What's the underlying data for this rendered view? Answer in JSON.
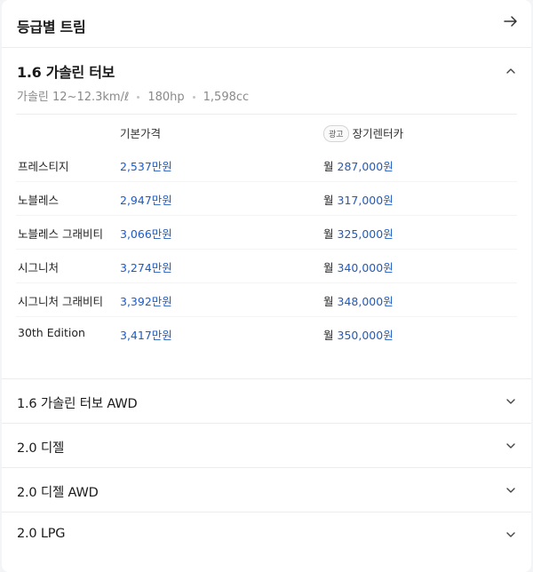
{
  "header": {
    "title": "등급별 트림"
  },
  "open_section": {
    "title": "1.6 가솔린 터보",
    "specs": [
      "가솔린 12~12.3km/ℓ",
      "180hp",
      "1,598cc"
    ],
    "columns": {
      "price": "기본가격",
      "ad_badge": "광고",
      "rent": "장기렌터카"
    },
    "rows": [
      {
        "name": "프레스티지",
        "price": "2,537",
        "price_unit": "만원",
        "rent_prefix": "월",
        "rent": "287,000원"
      },
      {
        "name": "노블레스",
        "price": "2,947",
        "price_unit": "만원",
        "rent_prefix": "월",
        "rent": "317,000원"
      },
      {
        "name": "노블레스 그래비티",
        "price": "3,066",
        "price_unit": "만원",
        "rent_prefix": "월",
        "rent": "325,000원"
      },
      {
        "name": "시그니처",
        "price": "3,274",
        "price_unit": "만원",
        "rent_prefix": "월",
        "rent": "340,000원"
      },
      {
        "name": "시그니처 그래비티",
        "price": "3,392",
        "price_unit": "만원",
        "rent_prefix": "월",
        "rent": "348,000원"
      },
      {
        "name": "30th Edition",
        "price": "3,417",
        "price_unit": "만원",
        "rent_prefix": "월",
        "rent": "350,000원"
      }
    ]
  },
  "collapsed_sections": [
    {
      "label": "1.6 가솔린 터보 AWD"
    },
    {
      "label": "2.0 디젤"
    },
    {
      "label": "2.0 디젤 AWD"
    },
    {
      "label": "2.0 LPG"
    }
  ],
  "colors": {
    "price_blue": "#1f5bbf",
    "border": "#ececec",
    "muted": "#8a8a8a"
  },
  "icons": {
    "header": "arrow-right-icon",
    "open": "chevron-up-icon",
    "closed": "chevron-down-icon"
  }
}
